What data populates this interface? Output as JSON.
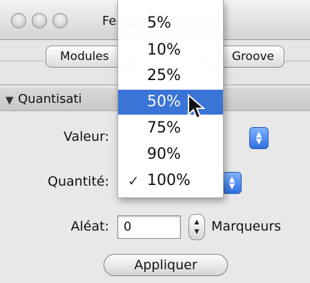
{
  "window": {
    "title_visible": "Fenêtre d'outils"
  },
  "tabs": {
    "modules": "Modules",
    "groove": "Groove"
  },
  "section": {
    "title": "Quantisati",
    "disclosure_icon": "triangle-down"
  },
  "form": {
    "valeur_label": "Valeur:",
    "quantite_label": "Quantité:",
    "aleat_label": "Aléat:",
    "aleat_value": "0",
    "marqueurs_label": "Marqueurs",
    "apply_label": "Appliquer"
  },
  "popup_menu": {
    "items": [
      "5%",
      "10%",
      "25%",
      "50%",
      "75%",
      "90%",
      "100%"
    ],
    "selected": "50%",
    "checked": "100%"
  },
  "colors": {
    "highlight": "#3a74d6",
    "select_arrow": "#2f6fe0"
  }
}
